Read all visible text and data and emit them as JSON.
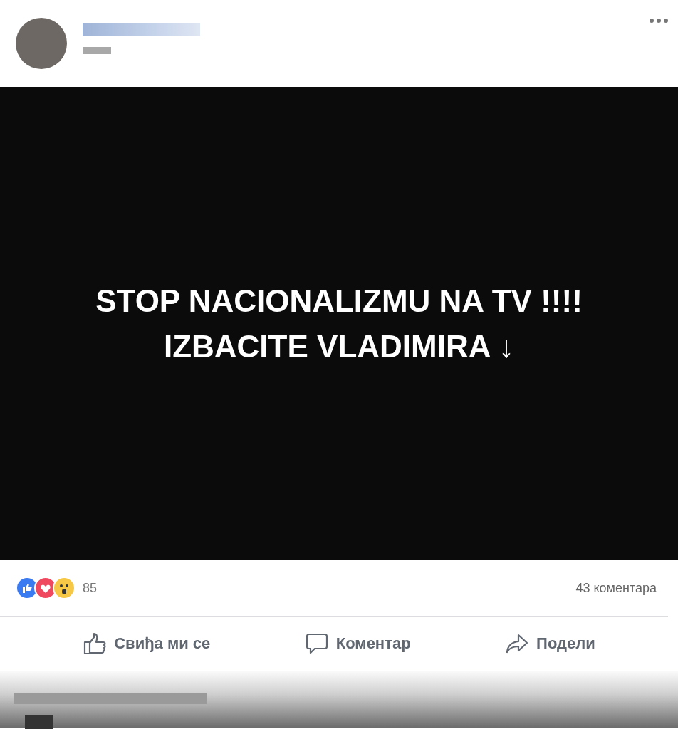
{
  "post": {
    "image_text": "STOP NACIONALIZMU NA TV !!!! IZBACITE VLADIMIRA ↓",
    "reaction_count": "85",
    "comment_count": "43 коментара",
    "actions": [
      {
        "kind": "like",
        "label": "Свиђа ми се"
      },
      {
        "kind": "comment",
        "label": "Коментар"
      },
      {
        "kind": "share",
        "label": "Подели"
      }
    ]
  }
}
